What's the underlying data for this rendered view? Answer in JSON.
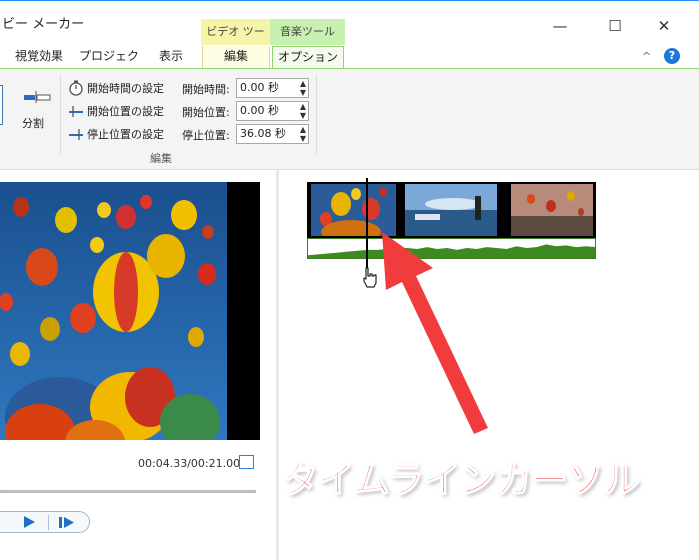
{
  "window": {
    "title": "ビー メーカー",
    "context_tabs": {
      "video_tools": "ビデオ ツール",
      "music_tools": "音楽ツール"
    },
    "controls": {
      "minimize": "—",
      "maximize": "☐",
      "close": "✕"
    }
  },
  "ribbon": {
    "tabs": {
      "visual_effects": "視覚効果",
      "project": "プロジェクト",
      "view": "表示",
      "edit": "編集",
      "options": "オプション"
    },
    "help_chevron": "^",
    "help_label": "?",
    "split_label": "分割",
    "commands": {
      "set_start_time": "開始時間の設定",
      "set_start_point": "開始位置の設定",
      "set_end_point": "停止位置の設定"
    },
    "fields": {
      "start_time": {
        "label": "開始時間:",
        "value": "0.00 秒"
      },
      "start_point": {
        "label": "開始位置:",
        "value": "0.00 秒"
      },
      "end_point": {
        "label": "停止位置:",
        "value": "36.08 秒"
      }
    },
    "group_label": "編集"
  },
  "preview": {
    "time_readout": "00:04.33/00:21.00"
  },
  "annotation": {
    "text": "タイムラインカーソル",
    "color": "#f03c3c"
  },
  "colors": {
    "accent_blue": "#1f6fc8",
    "video_tools_tab": "#f6f4a8",
    "music_tools_tab": "#c8f0b0",
    "audio_waveform": "#3d8a22"
  }
}
